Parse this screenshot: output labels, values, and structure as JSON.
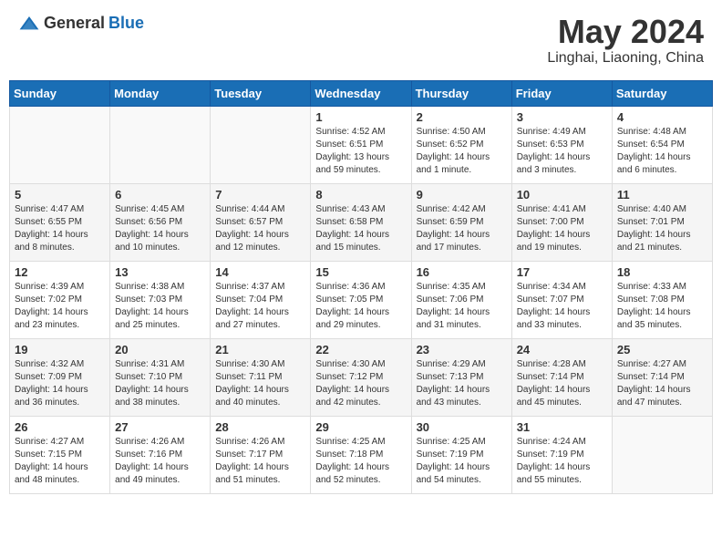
{
  "header": {
    "logo_general": "General",
    "logo_blue": "Blue",
    "month_title": "May 2024",
    "location": "Linghai, Liaoning, China"
  },
  "days_of_week": [
    "Sunday",
    "Monday",
    "Tuesday",
    "Wednesday",
    "Thursday",
    "Friday",
    "Saturday"
  ],
  "weeks": [
    [
      {
        "day": "",
        "info": ""
      },
      {
        "day": "",
        "info": ""
      },
      {
        "day": "",
        "info": ""
      },
      {
        "day": "1",
        "info": "Sunrise: 4:52 AM\nSunset: 6:51 PM\nDaylight: 13 hours\nand 59 minutes."
      },
      {
        "day": "2",
        "info": "Sunrise: 4:50 AM\nSunset: 6:52 PM\nDaylight: 14 hours\nand 1 minute."
      },
      {
        "day": "3",
        "info": "Sunrise: 4:49 AM\nSunset: 6:53 PM\nDaylight: 14 hours\nand 3 minutes."
      },
      {
        "day": "4",
        "info": "Sunrise: 4:48 AM\nSunset: 6:54 PM\nDaylight: 14 hours\nand 6 minutes."
      }
    ],
    [
      {
        "day": "5",
        "info": "Sunrise: 4:47 AM\nSunset: 6:55 PM\nDaylight: 14 hours\nand 8 minutes."
      },
      {
        "day": "6",
        "info": "Sunrise: 4:45 AM\nSunset: 6:56 PM\nDaylight: 14 hours\nand 10 minutes."
      },
      {
        "day": "7",
        "info": "Sunrise: 4:44 AM\nSunset: 6:57 PM\nDaylight: 14 hours\nand 12 minutes."
      },
      {
        "day": "8",
        "info": "Sunrise: 4:43 AM\nSunset: 6:58 PM\nDaylight: 14 hours\nand 15 minutes."
      },
      {
        "day": "9",
        "info": "Sunrise: 4:42 AM\nSunset: 6:59 PM\nDaylight: 14 hours\nand 17 minutes."
      },
      {
        "day": "10",
        "info": "Sunrise: 4:41 AM\nSunset: 7:00 PM\nDaylight: 14 hours\nand 19 minutes."
      },
      {
        "day": "11",
        "info": "Sunrise: 4:40 AM\nSunset: 7:01 PM\nDaylight: 14 hours\nand 21 minutes."
      }
    ],
    [
      {
        "day": "12",
        "info": "Sunrise: 4:39 AM\nSunset: 7:02 PM\nDaylight: 14 hours\nand 23 minutes."
      },
      {
        "day": "13",
        "info": "Sunrise: 4:38 AM\nSunset: 7:03 PM\nDaylight: 14 hours\nand 25 minutes."
      },
      {
        "day": "14",
        "info": "Sunrise: 4:37 AM\nSunset: 7:04 PM\nDaylight: 14 hours\nand 27 minutes."
      },
      {
        "day": "15",
        "info": "Sunrise: 4:36 AM\nSunset: 7:05 PM\nDaylight: 14 hours\nand 29 minutes."
      },
      {
        "day": "16",
        "info": "Sunrise: 4:35 AM\nSunset: 7:06 PM\nDaylight: 14 hours\nand 31 minutes."
      },
      {
        "day": "17",
        "info": "Sunrise: 4:34 AM\nSunset: 7:07 PM\nDaylight: 14 hours\nand 33 minutes."
      },
      {
        "day": "18",
        "info": "Sunrise: 4:33 AM\nSunset: 7:08 PM\nDaylight: 14 hours\nand 35 minutes."
      }
    ],
    [
      {
        "day": "19",
        "info": "Sunrise: 4:32 AM\nSunset: 7:09 PM\nDaylight: 14 hours\nand 36 minutes."
      },
      {
        "day": "20",
        "info": "Sunrise: 4:31 AM\nSunset: 7:10 PM\nDaylight: 14 hours\nand 38 minutes."
      },
      {
        "day": "21",
        "info": "Sunrise: 4:30 AM\nSunset: 7:11 PM\nDaylight: 14 hours\nand 40 minutes."
      },
      {
        "day": "22",
        "info": "Sunrise: 4:30 AM\nSunset: 7:12 PM\nDaylight: 14 hours\nand 42 minutes."
      },
      {
        "day": "23",
        "info": "Sunrise: 4:29 AM\nSunset: 7:13 PM\nDaylight: 14 hours\nand 43 minutes."
      },
      {
        "day": "24",
        "info": "Sunrise: 4:28 AM\nSunset: 7:14 PM\nDaylight: 14 hours\nand 45 minutes."
      },
      {
        "day": "25",
        "info": "Sunrise: 4:27 AM\nSunset: 7:14 PM\nDaylight: 14 hours\nand 47 minutes."
      }
    ],
    [
      {
        "day": "26",
        "info": "Sunrise: 4:27 AM\nSunset: 7:15 PM\nDaylight: 14 hours\nand 48 minutes."
      },
      {
        "day": "27",
        "info": "Sunrise: 4:26 AM\nSunset: 7:16 PM\nDaylight: 14 hours\nand 49 minutes."
      },
      {
        "day": "28",
        "info": "Sunrise: 4:26 AM\nSunset: 7:17 PM\nDaylight: 14 hours\nand 51 minutes."
      },
      {
        "day": "29",
        "info": "Sunrise: 4:25 AM\nSunset: 7:18 PM\nDaylight: 14 hours\nand 52 minutes."
      },
      {
        "day": "30",
        "info": "Sunrise: 4:25 AM\nSunset: 7:19 PM\nDaylight: 14 hours\nand 54 minutes."
      },
      {
        "day": "31",
        "info": "Sunrise: 4:24 AM\nSunset: 7:19 PM\nDaylight: 14 hours\nand 55 minutes."
      },
      {
        "day": "",
        "info": ""
      }
    ]
  ]
}
